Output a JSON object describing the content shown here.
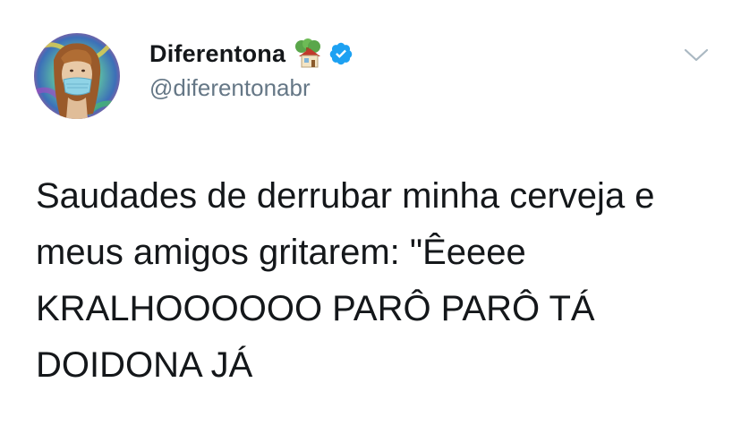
{
  "tweet": {
    "author": {
      "display_name": "Diferentona",
      "handle": "@diferentonabr",
      "name_emoji": "house-with-tree-icon",
      "verified": true
    },
    "text": "Saudades de derrubar minha cerveja e\nmeus amigos gritarem: \"Êeeee\nKRALHOOOOOO PARÔ PARÔ TÁ\nDOIDONA JÁ",
    "menu_icon": "chevron-down-icon"
  },
  "colors": {
    "verified_blue": "#1da1f2",
    "handle_gray": "#657786",
    "text": "#14171a",
    "chevron_gray": "#aab8c2"
  }
}
